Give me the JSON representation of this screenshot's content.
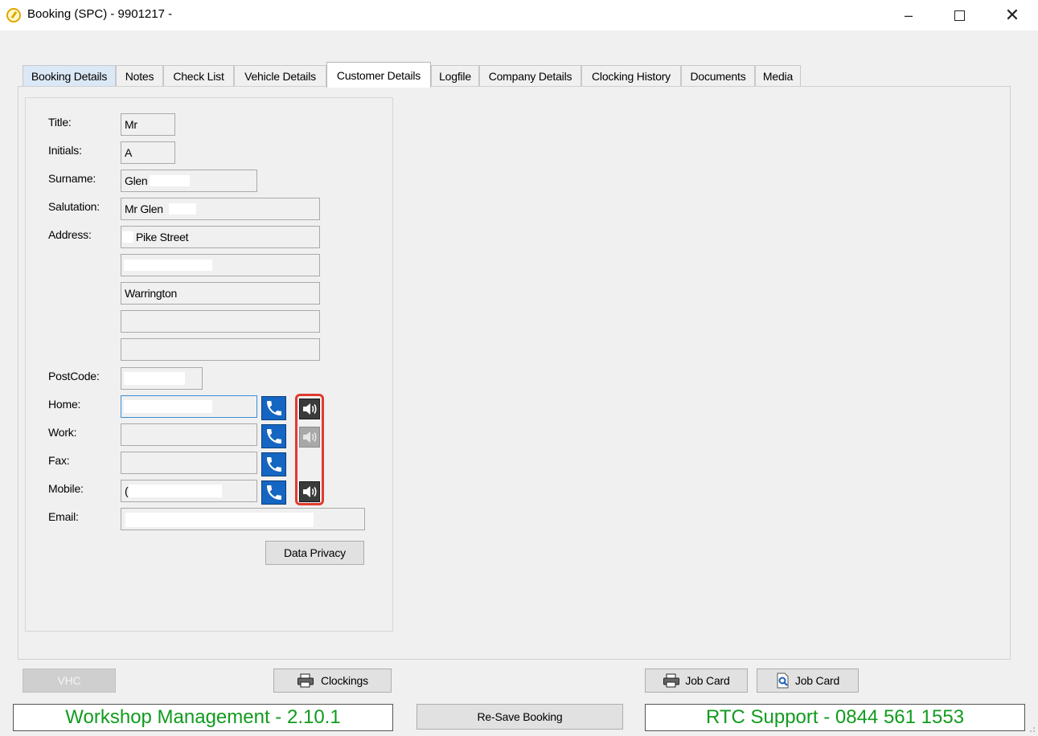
{
  "window": {
    "title": "Booking (SPC) - 9901217 -",
    "minimize_glyph": "–",
    "close_glyph": "✕"
  },
  "tabs": [
    {
      "label": "Booking Details"
    },
    {
      "label": "Notes"
    },
    {
      "label": "Check List"
    },
    {
      "label": "Vehicle Details"
    },
    {
      "label": "Customer Details",
      "active": true
    },
    {
      "label": "Logfile"
    },
    {
      "label": "Company Details"
    },
    {
      "label": "Clocking History"
    },
    {
      "label": "Documents"
    },
    {
      "label": "Media"
    }
  ],
  "customer": {
    "labels": {
      "title": "Title:",
      "initials": "Initials:",
      "surname": "Surname:",
      "salutation": "Salutation:",
      "address": "Address:",
      "postcode": "PostCode:",
      "home": "Home:",
      "work": "Work:",
      "fax": "Fax:",
      "mobile": "Mobile:",
      "email": "Email:"
    },
    "values": {
      "title": "Mr",
      "initials": "A",
      "surname": "Glen",
      "salutation": "Mr Glen",
      "address1": "Pike Street",
      "address2": "",
      "address3": "Warrington",
      "address4": "",
      "address5": "",
      "postcode": "",
      "home": "",
      "work": "",
      "fax": "",
      "mobile": "(",
      "email": ""
    },
    "data_privacy_label": "Data Privacy"
  },
  "icons": {
    "phone": "phone-icon",
    "speaker": "speaker-icon",
    "printer": "printer-icon",
    "preview": "print-preview-icon"
  },
  "buttons": {
    "vhc": "VHC",
    "clockings": "Clockings",
    "job_card_print": "Job Card",
    "job_card_preview": "Job Card",
    "resave": "Re-Save Booking"
  },
  "status": {
    "left": "Workshop Management - 2.10.1",
    "right": "RTC Support - 0844 561 1553"
  },
  "colors": {
    "status_text": "#119b1e",
    "phone_button": "#1566c2",
    "highlight": "#e03b2f",
    "app_icon": "#e0a800"
  }
}
